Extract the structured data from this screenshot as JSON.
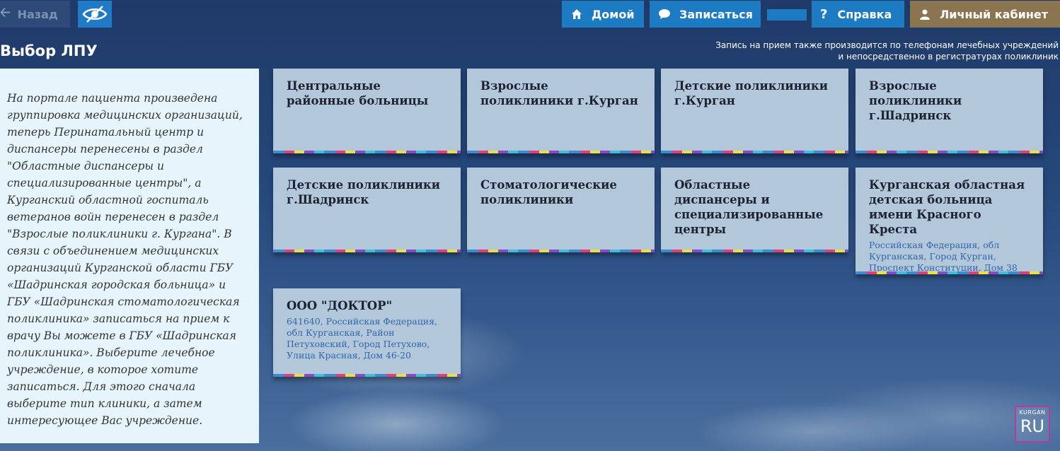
{
  "topbar": {
    "back_label": "Назад",
    "home_label": "Домой",
    "signup_label": "Записаться",
    "help_label": "Справка",
    "cabinet_label": "Личный кабинет"
  },
  "page": {
    "title": "Выбор ЛПУ",
    "notice_line1": "Запись на прием также производится по телефонам лечебных учреждений",
    "notice_line2": "и непосредственно в регистратурах поликлиник"
  },
  "info": {
    "text": "На портале пациента произведена группировка медицинских организаций, теперь Перинатальный центр и диспансеры перенесены в раздел \"Областные диспансеры и специализированные центры\", а Курганский областной госпиталь ветеранов войн перенесен в раздел \"Взрослые поликлиники г. Кургана\". В связи с объединением медицинских организаций Курганской области ГБУ «Шадринская городская больница» и ГБУ «Шадринская стоматологическая поликлиника» записаться на прием к врачу Вы можете в ГБУ «Шадринская поликлиника». Выберите лечебное учреждение, в которое хотите записаться. Для этого сначала выберите тип клиники, а затем интересующее Вас учреждение."
  },
  "tiles": [
    {
      "title": "Центральные районные больницы",
      "address": ""
    },
    {
      "title": "Взрослые поликлиники г.Курган",
      "address": ""
    },
    {
      "title": "Детские поликлиники г.Курган",
      "address": ""
    },
    {
      "title": "Взрослые поликлиники г.Шадринск",
      "address": ""
    },
    {
      "title": "Детские поликлиники г.Шадринск",
      "address": ""
    },
    {
      "title": "Стоматологические поликлиники",
      "address": ""
    },
    {
      "title": "Областные диспансеры и специализированные центры",
      "address": ""
    },
    {
      "title": "Курганская областная детская больница имени Красного Креста",
      "address": "Российская Федерация, обл Курганская, Город Курган, Проспект Конституции, Дом 38"
    },
    {
      "title": "ООО \"ДОКТОР\"",
      "address": "641640, Российская Федерация, обл Курганская, Район Петуховский, Город Петухово, Улица Красная, Дом 46-20"
    }
  ],
  "logo": {
    "small": "KURGAN",
    "big": "RU"
  },
  "colors": {
    "nav_blue": "#1c7bc3",
    "cabinet_brown": "#8b7450",
    "tile_bg": "#b3c7db",
    "address_blue": "#2f66a8"
  }
}
